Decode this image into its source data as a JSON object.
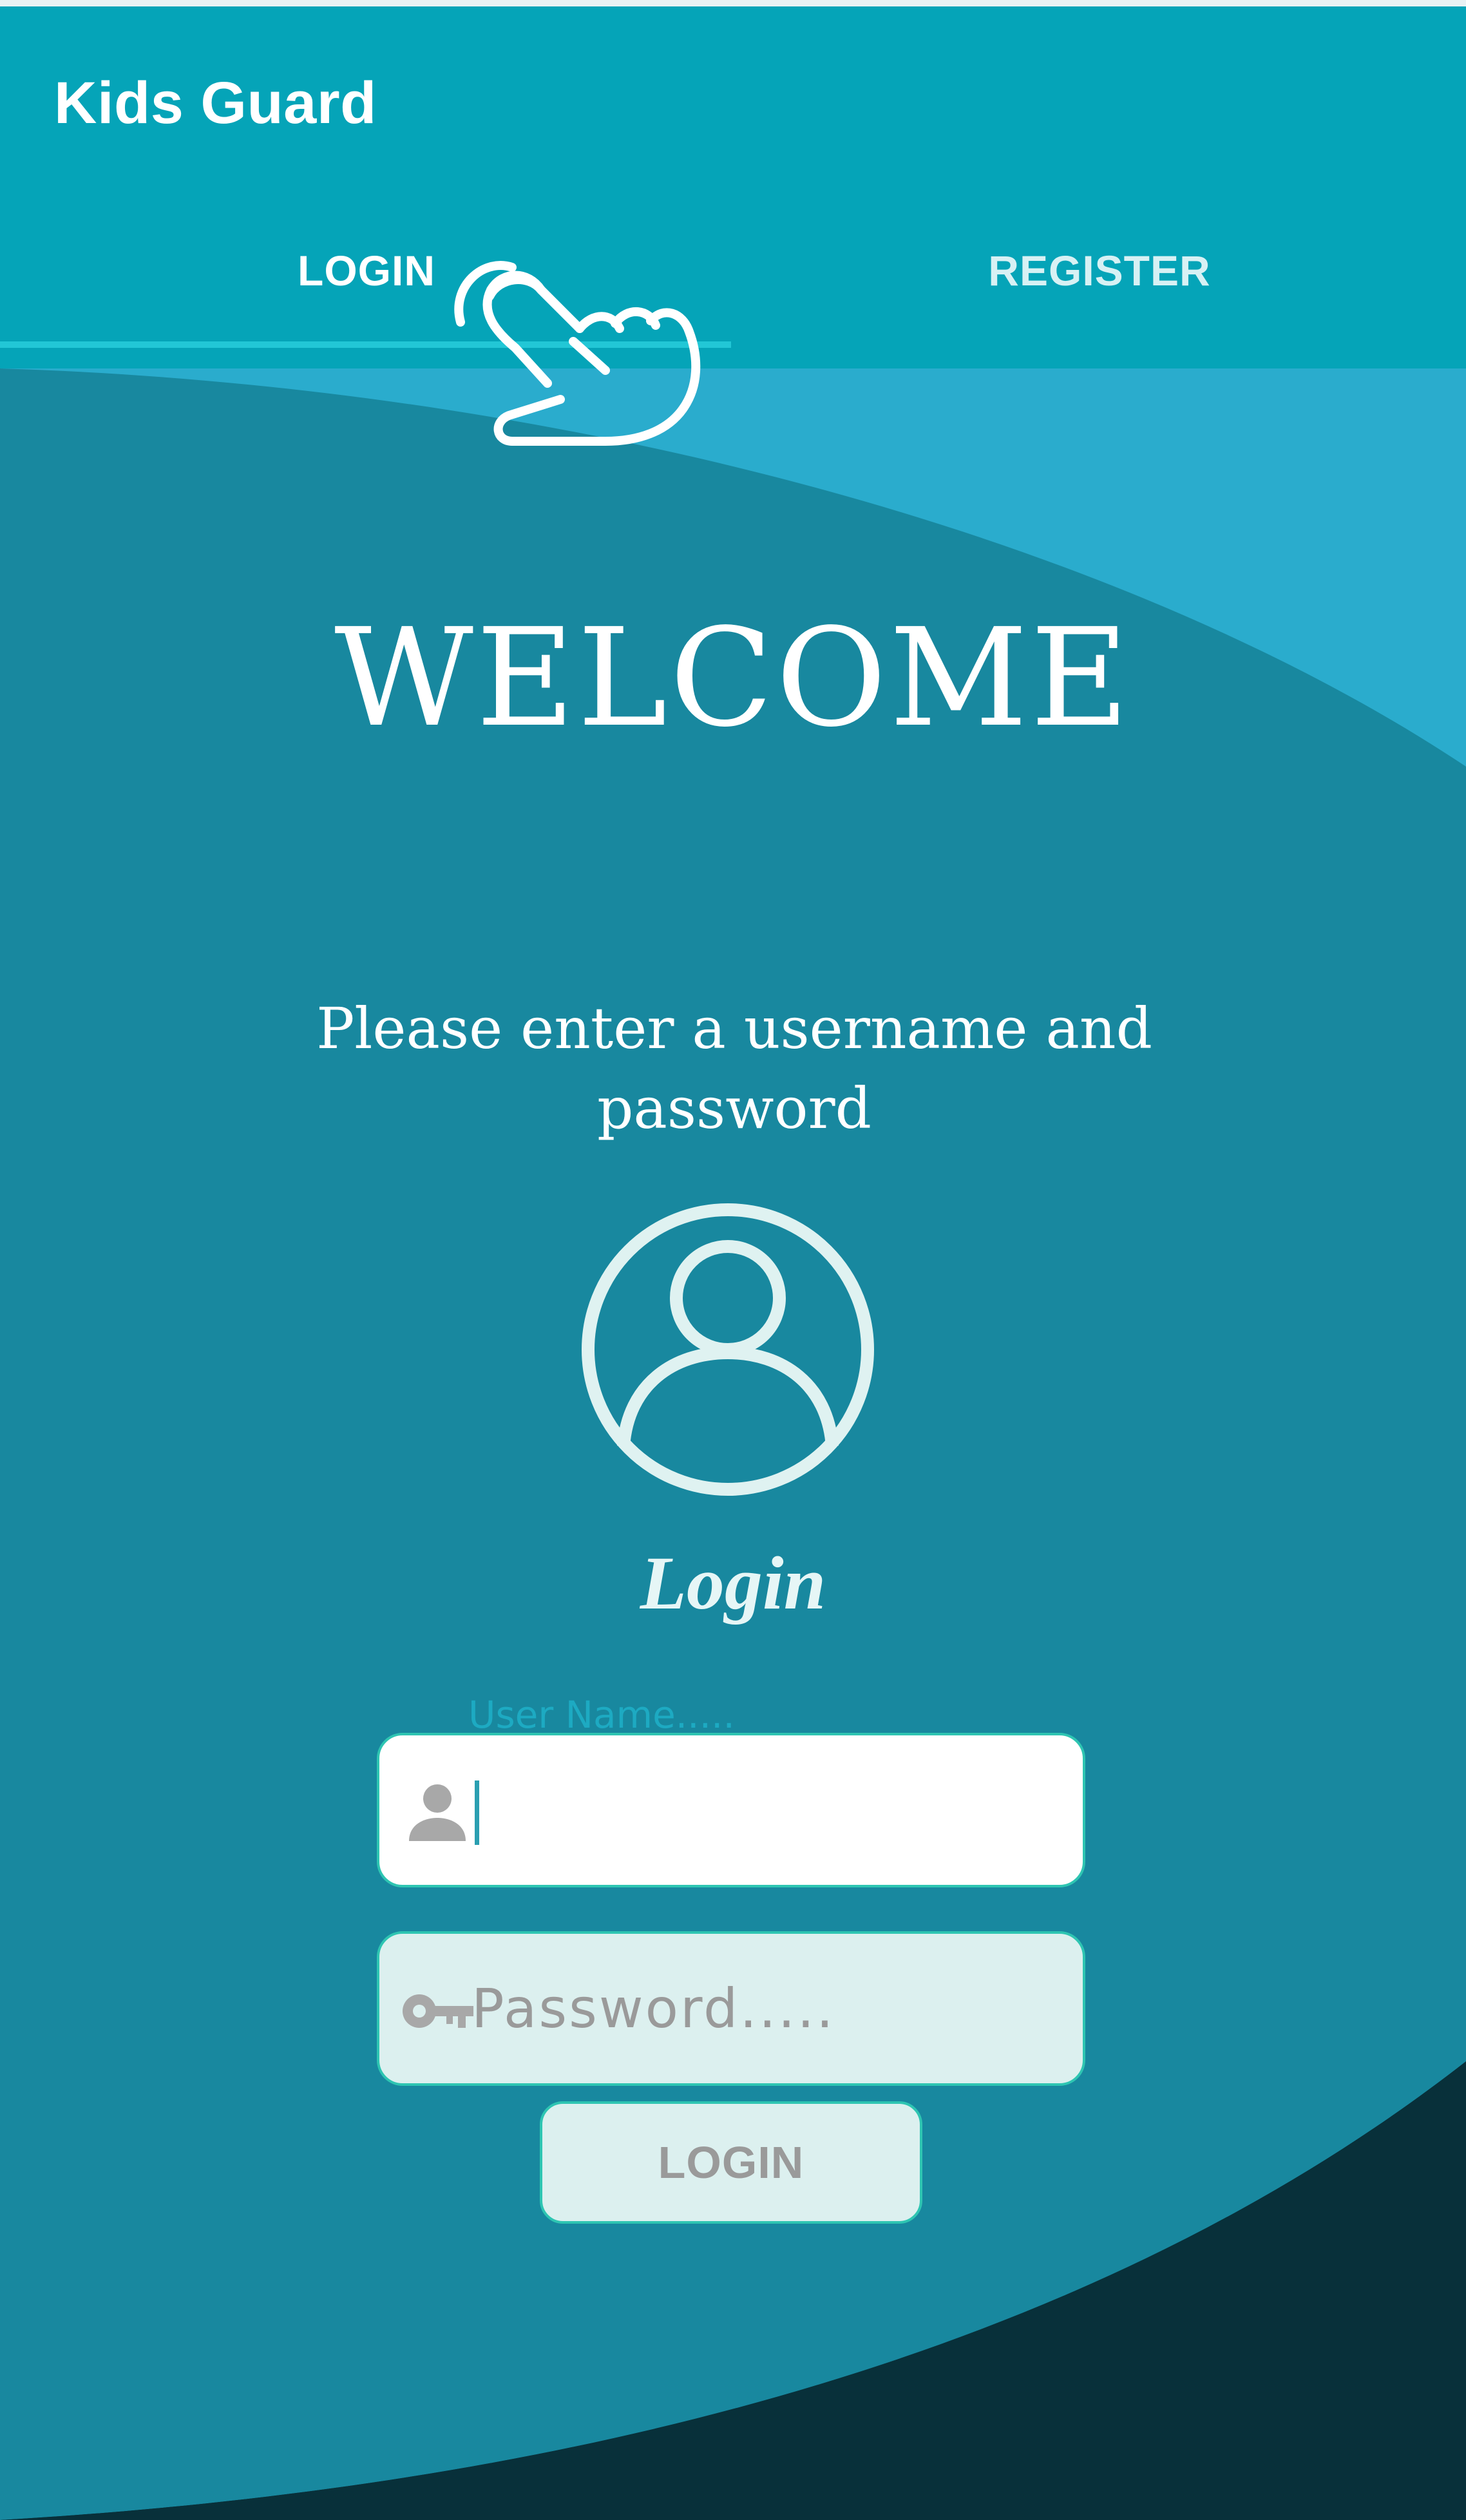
{
  "app": {
    "title": "Kids Guard"
  },
  "tabs": [
    {
      "label": "LOGIN",
      "selected": true
    },
    {
      "label": "REGISTER",
      "selected": false
    }
  ],
  "welcome": {
    "heading": "WELCOME",
    "instruction": "Please enter a username and password"
  },
  "login_caption": "Login",
  "form": {
    "username_label": "User Name.....",
    "username_value": "",
    "password_placeholder": "Password.....",
    "login_button": "LOGIN"
  },
  "icons": {
    "pointer": "hand-pointer-icon",
    "avatar": "user-circle-icon",
    "user_field": "person-icon",
    "password_field": "key-icon"
  },
  "colors": {
    "app_bar": "#05a4b8",
    "background_light": "#2aaccd",
    "background_main": "#18889f",
    "background_dark": "#0d2b36",
    "field_border": "#2ec5b2",
    "button_bg": "#dcf0ef"
  }
}
